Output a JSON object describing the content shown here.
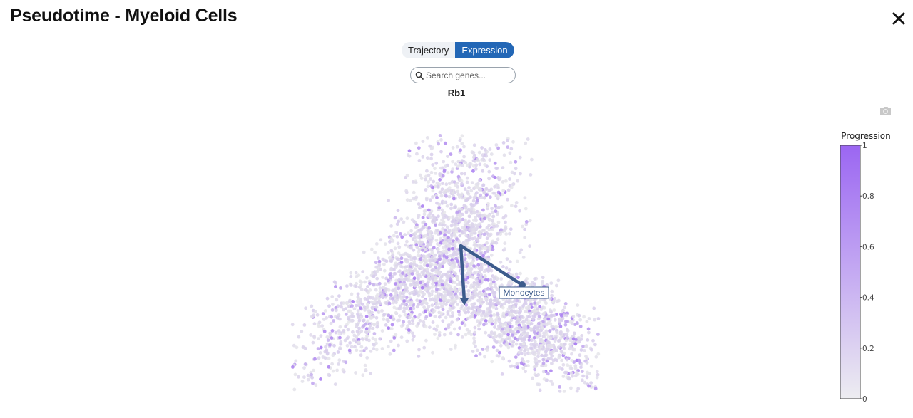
{
  "header": {
    "title": "Pseudotime - Myeloid Cells",
    "close_icon": "close-icon"
  },
  "view_toggle": {
    "options": [
      {
        "label": "Trajectory",
        "active": false
      },
      {
        "label": "Expression",
        "active": true
      }
    ]
  },
  "search": {
    "placeholder": "Search genes...",
    "value": ""
  },
  "selected_gene": "Rb1",
  "toolbar": {
    "camera_icon": "camera-icon"
  },
  "plot": {
    "trajectory_label": "Monocytes",
    "colors": {
      "accent": "#2367b6",
      "trajectory": "#3c5b8c",
      "cell_low": "#e6e6ea",
      "cell_high": "#9b66f2"
    },
    "colorbar": {
      "title": "Progression",
      "range": [
        0,
        1
      ],
      "ticks": [
        "0",
        "0.2",
        "0.4",
        "0.6",
        "0.8",
        "1"
      ]
    }
  }
}
